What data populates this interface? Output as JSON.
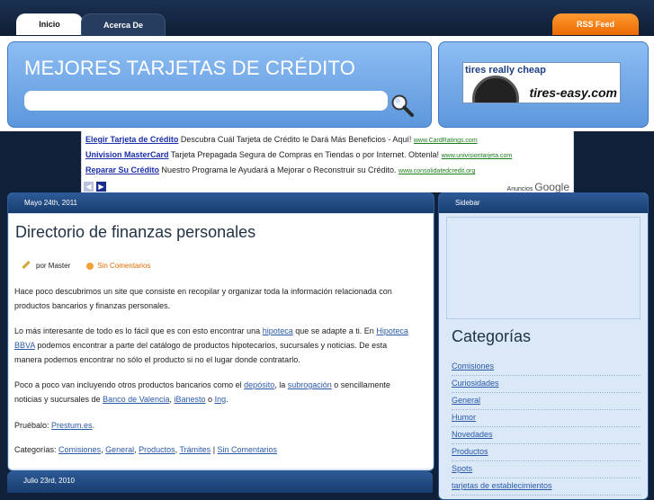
{
  "nav": {
    "tabs": [
      {
        "label": "Inicio"
      },
      {
        "label": "Acerca De"
      }
    ],
    "rss_label": "RSS Feed"
  },
  "header": {
    "title": "MEJORES TARJETAS DE CRÉDITO",
    "search_placeholder": "",
    "ad_banner": {
      "headline": "tires really cheap",
      "brand": "tires-easy.com"
    }
  },
  "adsense": {
    "items": [
      {
        "title": "Elegir Tarjeta de Crédito",
        "text": "Descubra Cuál Tarjeta de Crédito le Dará Más Beneficios - Aquí!",
        "url": "www.CardRatings.com"
      },
      {
        "title": "Univision MasterCard",
        "text": "Tarjeta Prepagada Segura de Compras en Tiendas o por Internet. Obtenla!",
        "url": "www.univisiontarjeta.com"
      },
      {
        "title": "Reparar Su Crédito",
        "text": "Nuestro Programa le Ayudará a Mejorar o Reconstruir su Crédito.",
        "url": "www.consolidatedcredit.org"
      }
    ],
    "ads_by": "Anuncios",
    "google": "Google"
  },
  "post": {
    "date": "Mayo 24th, 2011",
    "title": "Directorio de finanzas personales",
    "author_prefix": "por",
    "author": "Master",
    "comments": "Sin Comentarios",
    "p1": "Hace poco descubrimos un site que consiste en recopilar y organizar toda la información relacionada con productos bancarios y finanzas personales.",
    "p2_a": "Lo más interesante de todo es lo fácil que es con esto encontrar una",
    "p2_link1": "hipoteca",
    "p2_b": "que se adapte a ti. En",
    "p2_link2": "Hipoteca BBVA",
    "p2_c": "podemos encontrar a parte del catálogo de productos hipotecarios, sucursales y noticias. De esta manera podemos encontrar no sólo el producto si no el lugar donde contratarlo.",
    "p3_a": "Poco a poco van incluyendo otros productos bancarios como el",
    "p3_link1": "depósito",
    "p3_b": ", la",
    "p3_link2": "subrogación",
    "p3_c": "o sencillamente noticias y sucursales de",
    "p3_link3": "Banco de Valencia",
    "p3_d": ",",
    "p3_link4": "iBanesto",
    "p3_e": "o",
    "p3_link5": "Ing",
    "p3_f": ".",
    "p4_a": "Pruébalo:",
    "p4_link": "Prestum.es",
    "p4_b": ".",
    "cats_label": "Categorías:",
    "categories": [
      "Comisiones",
      "General",
      "Productos",
      "Trámites",
      "Sin Comentarios"
    ]
  },
  "post2": {
    "date": "Julio 23rd, 2010"
  },
  "sidebar": {
    "heading": "Sidebar",
    "categories_title": "Categorías",
    "categories": [
      "Comisiones",
      "Curiosidades",
      "General",
      "Humor",
      "Novedades",
      "Productos",
      "Spots",
      "tarjetas de establecimientos"
    ]
  }
}
